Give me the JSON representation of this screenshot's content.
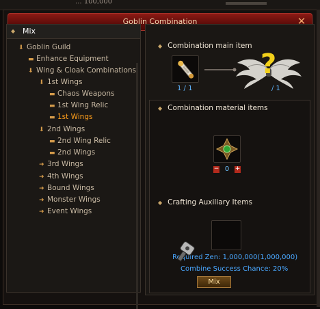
{
  "topstrip": {
    "text": "...  100,000"
  },
  "window": {
    "title": "Goblin Combination",
    "close_glyph": "✕"
  },
  "tree": {
    "header": "Mix",
    "items": [
      {
        "icon": "arrow-down",
        "glyph": "⬇",
        "label": "Goblin Guild",
        "active": false
      },
      {
        "icon": "dash",
        "glyph": "▬",
        "label": "Enhance Equipment",
        "active": false
      },
      {
        "icon": "arrow-down",
        "glyph": "⬇",
        "label": "Wing & Cloak Combinations",
        "active": false
      },
      {
        "icon": "arrow-down",
        "glyph": "⬇",
        "label": "1st Wings",
        "active": false
      },
      {
        "icon": "dash",
        "glyph": "▬",
        "label": "Chaos Weapons",
        "active": false
      },
      {
        "icon": "dash",
        "glyph": "▬",
        "label": "1st Wing Relic",
        "active": false
      },
      {
        "icon": "dash",
        "glyph": "▬",
        "label": "1st Wings",
        "active": true
      },
      {
        "icon": "arrow-down",
        "glyph": "⬇",
        "label": "2nd Wings",
        "active": false
      },
      {
        "icon": "dash",
        "glyph": "▬",
        "label": "2nd Wing Relic",
        "active": false
      },
      {
        "icon": "dash",
        "glyph": "▬",
        "label": "2nd Wings",
        "active": false
      },
      {
        "icon": "arrow-right",
        "glyph": "➜",
        "label": "3rd Wings",
        "active": false
      },
      {
        "icon": "arrow-right",
        "glyph": "➜",
        "label": "4th Wings",
        "active": false
      },
      {
        "icon": "arrow-right",
        "glyph": "➜",
        "label": "Bound Wings",
        "active": false
      },
      {
        "icon": "arrow-right",
        "glyph": "➜",
        "label": "Monster Wings",
        "active": false
      },
      {
        "icon": "arrow-right",
        "glyph": "➜",
        "label": "Event Wings",
        "active": false
      }
    ]
  },
  "main": {
    "section1": "Combination main item",
    "main_item_count": "1 / 1",
    "result_item_count": "/ 1",
    "result_unknown": "?",
    "section2": "Combination material items",
    "material_count": "0",
    "section3": "Crafting Auxiliary Items",
    "required_zen": "Required Zen: 1,000,000(1,000,000)",
    "success_chance": "Combine Success Chance: 20%",
    "mix_button": "Mix"
  },
  "colors": {
    "accent": "#ff9e1b",
    "info": "#4aa8ff",
    "title_bar": "#8d1a14"
  }
}
